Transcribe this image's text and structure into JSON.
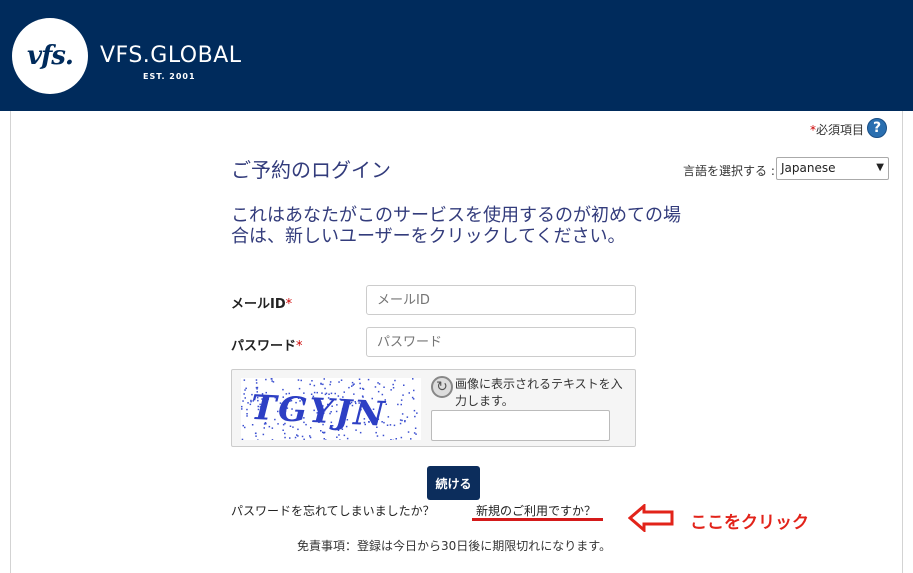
{
  "header": {
    "logo_text": "vfs.",
    "brand_name": "VFS.GLOBAL",
    "brand_est": "EST. 2001"
  },
  "required_note": {
    "star": "*",
    "text": "必須項目",
    "help_icon": "?"
  },
  "page_title": "ご予約のログイン",
  "language": {
    "label": "言語を選択する :",
    "selected": "Japanese",
    "arrow": "▼"
  },
  "notice": "これはあなたがこのサービスを使用するのが初めての場合は、新しいユーザーをクリックしてください。",
  "form": {
    "email_label": "メールID",
    "email_placeholder": "メールID",
    "password_label": "パスワード",
    "password_placeholder": "パスワード",
    "required_star": "*"
  },
  "captcha": {
    "text": "TGYJN",
    "hint": "画像に表示されるテキストを入力します。",
    "refresh_icon": "↻"
  },
  "continue_label": "続ける",
  "links": {
    "forgot": "パスワードを忘れてしまいましたか？",
    "new_user": "新規のご利用ですか？"
  },
  "annotation": {
    "click_here": "ここをクリック",
    "color": "#e2231a"
  },
  "disclaimer": "免責事項：登録は今日から30日後に期限切れになります。"
}
